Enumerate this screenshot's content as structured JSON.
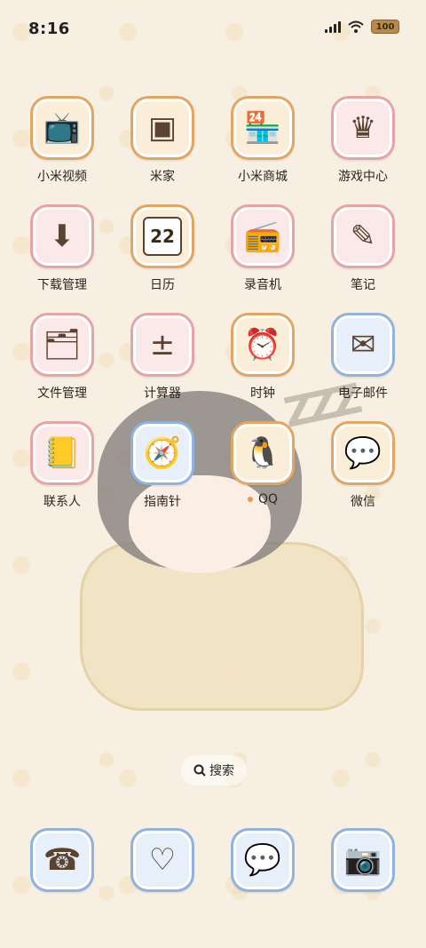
{
  "status_bar": {
    "time": "8:16",
    "battery": "100"
  },
  "apps": [
    {
      "label": "小米视频",
      "icon": "tv-cat-icon",
      "glyph": "📺",
      "theme": "orange"
    },
    {
      "label": "米家",
      "icon": "smart-home-device-icon",
      "glyph": "▣",
      "theme": "orange"
    },
    {
      "label": "小米商城",
      "icon": "shop-awning-icon",
      "glyph": "🏪",
      "theme": "orange"
    },
    {
      "label": "游戏中心",
      "icon": "crown-icon",
      "glyph": "♛",
      "theme": "pink"
    },
    {
      "label": "下载管理",
      "icon": "download-arrow-icon",
      "glyph": "⬇",
      "theme": "pink"
    },
    {
      "label": "日历",
      "icon": "calendar-icon",
      "glyph": "22",
      "theme": "orange"
    },
    {
      "label": "录音机",
      "icon": "radio-recorder-icon",
      "glyph": "📻",
      "theme": "pink"
    },
    {
      "label": "笔记",
      "icon": "notebook-pencil-icon",
      "glyph": "✎",
      "theme": "pink"
    },
    {
      "label": "文件管理",
      "icon": "file-folder-icon",
      "glyph": "🗂",
      "theme": "pink"
    },
    {
      "label": "计算器",
      "icon": "calculator-symbols-icon",
      "glyph": "±",
      "theme": "pink"
    },
    {
      "label": "时钟",
      "icon": "alarm-clock-icon",
      "glyph": "⏰",
      "theme": "orange"
    },
    {
      "label": "电子邮件",
      "icon": "envelope-icon",
      "glyph": "✉",
      "theme": "blue"
    },
    {
      "label": "联系人",
      "icon": "contact-book-icon",
      "glyph": "📒",
      "theme": "pink"
    },
    {
      "label": "指南针",
      "icon": "compass-icon",
      "glyph": "🧭",
      "theme": "blue"
    },
    {
      "label": "QQ",
      "icon": "penguin-icon",
      "glyph": "🐧",
      "theme": "orange",
      "badge": true
    },
    {
      "label": "微信",
      "icon": "chat-bubbles-icon",
      "glyph": "💬",
      "theme": "orange"
    }
  ],
  "search": {
    "label": "搜索"
  },
  "dock": [
    {
      "icon": "phone-icon",
      "glyph": "☎",
      "theme": "blue"
    },
    {
      "icon": "planet-heart-browser-icon",
      "glyph": "♡",
      "theme": "blue"
    },
    {
      "icon": "message-dots-icon",
      "glyph": "💬",
      "theme": "blue"
    },
    {
      "icon": "camera-cat-icon",
      "glyph": "📷",
      "theme": "blue"
    }
  ]
}
